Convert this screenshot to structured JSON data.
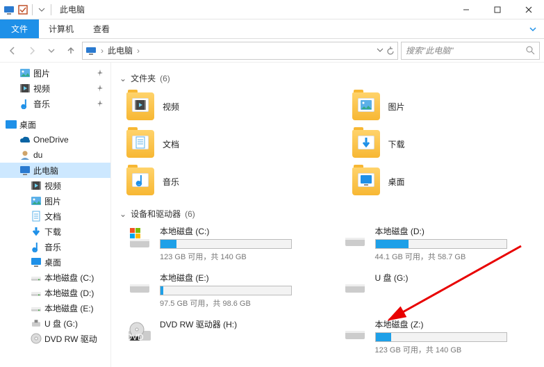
{
  "window": {
    "title": "此电脑",
    "min": "—",
    "max": "☐",
    "close": "✕"
  },
  "ribbon": {
    "file": "文件",
    "computer": "计算机",
    "view": "查看"
  },
  "nav": {
    "location_icon": "pc",
    "crumb1": "此电脑",
    "search_placeholder": "搜索\"此电脑\""
  },
  "sidebar": {
    "quick": [
      {
        "label": "图片",
        "icon": "picture"
      },
      {
        "label": "视频",
        "icon": "video"
      },
      {
        "label": "音乐",
        "icon": "music"
      }
    ],
    "desktop": "桌面",
    "desktop_children": [
      {
        "label": "OneDrive",
        "icon": "onedrive"
      },
      {
        "label": "du",
        "icon": "user"
      },
      {
        "label": "此电脑",
        "icon": "pc",
        "selected": true
      }
    ],
    "pc_children": [
      {
        "label": "视频",
        "icon": "video"
      },
      {
        "label": "图片",
        "icon": "picture"
      },
      {
        "label": "文档",
        "icon": "doc"
      },
      {
        "label": "下载",
        "icon": "download"
      },
      {
        "label": "音乐",
        "icon": "music"
      },
      {
        "label": "桌面",
        "icon": "desktop"
      },
      {
        "label": "本地磁盘 (C:)",
        "icon": "drive"
      },
      {
        "label": "本地磁盘 (D:)",
        "icon": "drive"
      },
      {
        "label": "本地磁盘 (E:)",
        "icon": "drive"
      },
      {
        "label": "U 盘 (G:)",
        "icon": "usb"
      },
      {
        "label": "DVD RW 驱动",
        "icon": "dvd"
      }
    ]
  },
  "groups": {
    "folders": {
      "title": "文件夹",
      "count": "(6)"
    },
    "devices": {
      "title": "设备和驱动器",
      "count": "(6)"
    }
  },
  "folders": [
    {
      "label": "视频",
      "inner": "video"
    },
    {
      "label": "图片",
      "inner": "picture"
    },
    {
      "label": "文档",
      "inner": "doc"
    },
    {
      "label": "下载",
      "inner": "download"
    },
    {
      "label": "音乐",
      "inner": "music"
    },
    {
      "label": "桌面",
      "inner": "desktop"
    }
  ],
  "drives": [
    {
      "name": "本地磁盘 (C:)",
      "info": "123 GB 可用，共 140 GB",
      "fill": 12,
      "icon": "os"
    },
    {
      "name": "本地磁盘 (D:)",
      "info": "44.1 GB 可用，共 58.7 GB",
      "fill": 25,
      "icon": "hdd"
    },
    {
      "name": "本地磁盘 (E:)",
      "info": "97.5 GB 可用，共 98.6 GB",
      "fill": 2,
      "icon": "hdd"
    },
    {
      "name": "U 盘 (G:)",
      "info": "",
      "fill": null,
      "icon": "usb"
    },
    {
      "name": "DVD RW 驱动器 (H:)",
      "info": "",
      "fill": null,
      "icon": "dvd"
    },
    {
      "name": "本地磁盘 (Z:)",
      "info": "123 GB 可用，共 140 GB",
      "fill": 12,
      "icon": "hdd"
    }
  ]
}
